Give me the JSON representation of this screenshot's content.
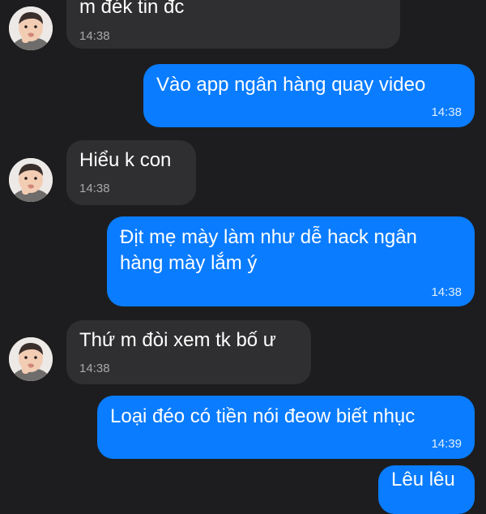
{
  "messages": [
    {
      "direction": "in",
      "text": "m đék tin đc",
      "time": "14:38"
    },
    {
      "direction": "out",
      "text": "Vào app ngân hàng quay video",
      "time": "14:38"
    },
    {
      "direction": "in",
      "text": "Hiểu k con",
      "time": "14:38"
    },
    {
      "direction": "out",
      "text": "Địt mẹ mày làm như dễ hack ngân hàng mày lắm ý",
      "time": "14:38"
    },
    {
      "direction": "in",
      "text": "Thứ m đòi xem tk bố ư",
      "time": "14:38"
    },
    {
      "direction": "out",
      "text": "Loại đéo có tiền nói đeow biết nhục",
      "time": "14:39"
    },
    {
      "direction": "out",
      "text": "Lêu lêu",
      "time": ""
    }
  ],
  "colors": {
    "background": "#1d1d1f",
    "incoming_bubble": "#2f2f31",
    "outgoing_bubble": "#0a7cff"
  }
}
